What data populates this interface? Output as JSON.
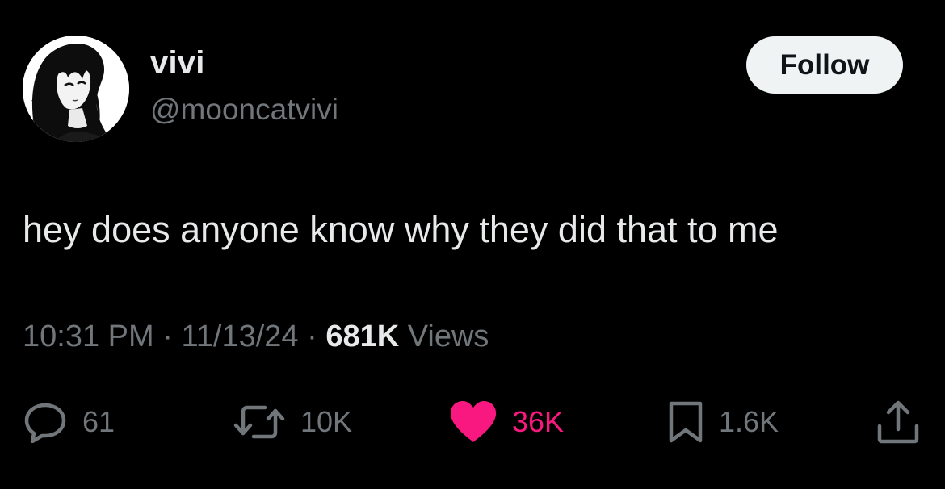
{
  "author": {
    "display_name": "vivi",
    "handle": "@mooncatvivi",
    "avatar_icon": "avatar-illustration"
  },
  "follow_label": "Follow",
  "tweet": {
    "text": "hey does anyone know why they did that to me"
  },
  "meta": {
    "time": "10:31 PM",
    "separator": "·",
    "date": "11/13/24",
    "views_count": "681K",
    "views_label": "Views"
  },
  "actions": {
    "reply": {
      "icon": "reply-icon",
      "count": "61"
    },
    "retweet": {
      "icon": "retweet-icon",
      "count": "10K"
    },
    "like": {
      "icon": "heart-icon",
      "count": "36K",
      "active": true
    },
    "bookmark": {
      "icon": "bookmark-icon",
      "count": "1.6K"
    },
    "share": {
      "icon": "share-icon"
    }
  },
  "colors": {
    "background": "#000000",
    "primary_text": "#e7e9ea",
    "secondary_text": "#71767b",
    "like_active": "#f91880",
    "follow_button_bg": "#eff3f4"
  }
}
